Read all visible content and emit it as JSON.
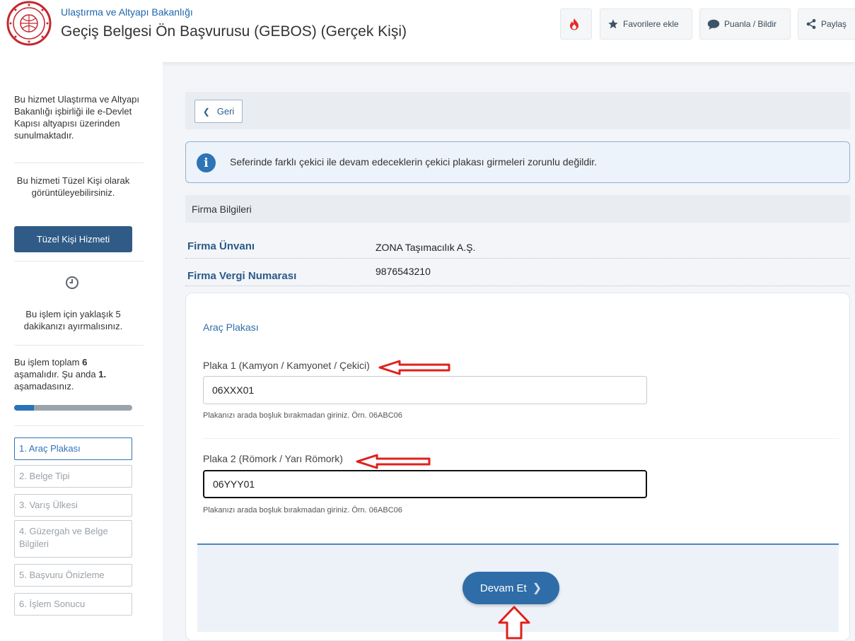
{
  "header": {
    "ministry": "Ulaştırma ve Altyapı Bakanlığı",
    "title": "Geçiş Belgesi Ön Başvurusu (GEBOS) (Gerçek Kişi)",
    "buttons": {
      "favorite": "Favorilere ekle",
      "rate": "Puanla / Bildir",
      "share": "Paylaş"
    }
  },
  "sidebar": {
    "about": "Bu hizmet Ulaştırma ve Altyapı Bakanlığı işbirliği ile e-Devlet Kapısı altyapısı üzerinden sunulmaktadır.",
    "tuzel_info": "Bu hizmeti Tüzel Kişi olarak görüntüleyebilirsiniz.",
    "tuzel_button": "Tüzel Kişi Hizmeti",
    "time_info": "Bu işlem için yaklaşık 5 dakikanızı ayırmalısınız.",
    "stage_prefix": "Bu işlem toplam ",
    "stage_total": "6",
    "stage_mid": " aşamalıdır. Şu anda ",
    "stage_current": "1.",
    "stage_suffix": " aşamadasınız.",
    "progress": 0.17,
    "steps": [
      {
        "label": "1. Araç Plakası",
        "active": true
      },
      {
        "label": "2. Belge Tipi",
        "active": false
      },
      {
        "label": "3. Varış Ülkesi",
        "active": false
      },
      {
        "label": "4. Güzergah ve Belge Bilgileri",
        "active": false
      },
      {
        "label": "5. Başvuru Önizleme",
        "active": false
      },
      {
        "label": "6. İşlem Sonucu",
        "active": false
      }
    ]
  },
  "main": {
    "back_label": "Geri",
    "info_text": "Seferinde farklı çekici ile devam edeceklerin çekici plakası girmeleri zorunlu değildir.",
    "firm_section": "Firma Bilgileri",
    "firm_name_label": "Firma Ünvanı",
    "firm_name_value": "ZONA Taşımacılık A.Ş.",
    "firm_tax_label": "Firma Vergi Numarası",
    "firm_tax_value": "9876543210",
    "plate_section": "Araç Plakası",
    "plate1_label": "Plaka 1 (Kamyon / Kamyonet / Çekici)",
    "plate1_value": "06XXX01",
    "plate2_label": "Plaka 2 (Römork / Yarı Römork)",
    "plate2_value": "06YYY01",
    "hint": "Plakanızı arada boşluk bırakmadan giriniz. Örn. 06ABC06",
    "continue_label": "Devam Et"
  },
  "colors": {
    "accent": "#2f6da8",
    "annotation": "#e0201b"
  }
}
